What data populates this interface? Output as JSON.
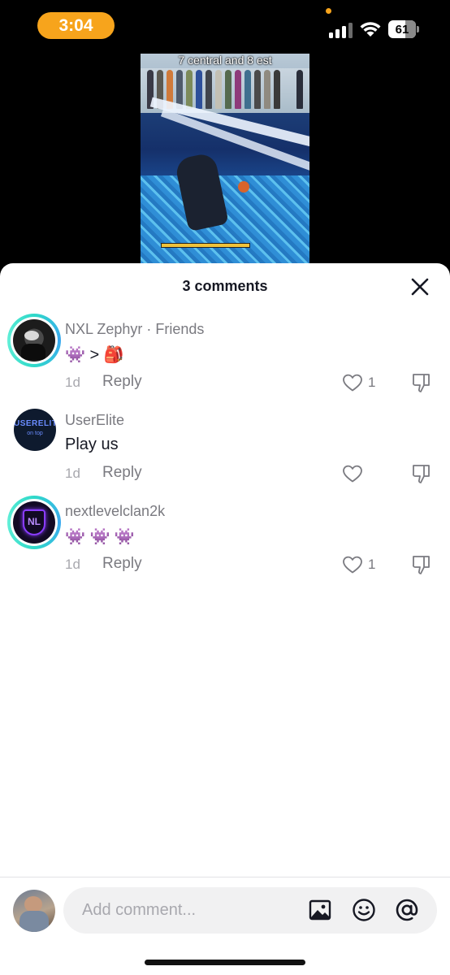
{
  "status_bar": {
    "time": "3:04",
    "battery": "61",
    "accent_color": "#f7a41c"
  },
  "video": {
    "caption": "7 central and 8 est"
  },
  "sheet": {
    "title": "3 comments",
    "close_icon": "close-icon"
  },
  "comments": [
    {
      "username": "NXL Zephyr · Friends",
      "text": "👾 > 🎒",
      "time": "1d",
      "reply_label": "Reply",
      "likes": "1"
    },
    {
      "username": "UserElite",
      "avatar_text": "USERELITE",
      "avatar_subtext": "on top",
      "text": "Play us",
      "time": "1d",
      "reply_label": "Reply",
      "likes": ""
    },
    {
      "username": "nextlevelclan2k",
      "avatar_text": "NL",
      "text": "👾 👾 👾",
      "time": "1d",
      "reply_label": "Reply",
      "likes": "1"
    }
  ],
  "composer": {
    "placeholder": "Add comment...",
    "icons": [
      "image-icon",
      "emoji-icon",
      "mention-icon"
    ]
  }
}
